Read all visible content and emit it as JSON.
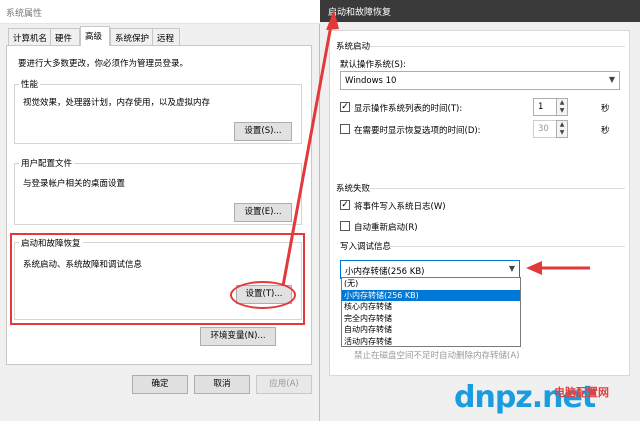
{
  "system_properties": {
    "title": "系统属性",
    "tabs": [
      "计算机名",
      "硬件",
      "高级",
      "系统保护",
      "远程"
    ],
    "admin_note": "要进行大多数更改，你必须作为管理员登录。",
    "performance": {
      "title": "性能",
      "desc": "视觉效果，处理器计划，内存使用，以及虚拟内存",
      "button": "设置(S)..."
    },
    "user_profiles": {
      "title": "用户配置文件",
      "desc": "与登录帐户相关的桌面设置",
      "button": "设置(E)..."
    },
    "startup_recovery": {
      "title": "启动和故障恢复",
      "desc": "系统启动、系统故障和调试信息",
      "button": "设置(T)..."
    },
    "env_button": "环境变量(N)...",
    "ok": "确定",
    "cancel": "取消",
    "apply": "应用(A)"
  },
  "startup_dialog": {
    "title": "启动和故障恢复",
    "system_startup": "系统启动",
    "default_os_label": "默认操作系统(S):",
    "default_os_value": "Windows 10",
    "show_os_list": "显示操作系统列表的时间(T):",
    "show_os_list_value": "1",
    "show_recovery": "在需要时显示恢复选项的时间(D):",
    "show_recovery_value": "30",
    "seconds": "秒",
    "system_failure": "系统失败",
    "write_event": "将事件写入系统日志(W)",
    "auto_restart": "自动重新启动(R)",
    "debug_info": "写入调试信息",
    "debug_selected": "小内存转储(256 KB)",
    "debug_options": [
      "(无)",
      "小内存转储(256 KB)",
      "核心内存转储",
      "完全内存转储",
      "自动内存转储",
      "活动内存转储"
    ],
    "overwrite_note": "禁止在磁盘空间不足时自动删除内存转储(A)"
  },
  "watermark": {
    "text": "dnpz.net",
    "sub": "电脑配置网"
  },
  "colors": {
    "annotation_red": "#e23a3a",
    "selection_blue": "#0078d7",
    "title_dark": "#3a3a3a"
  }
}
